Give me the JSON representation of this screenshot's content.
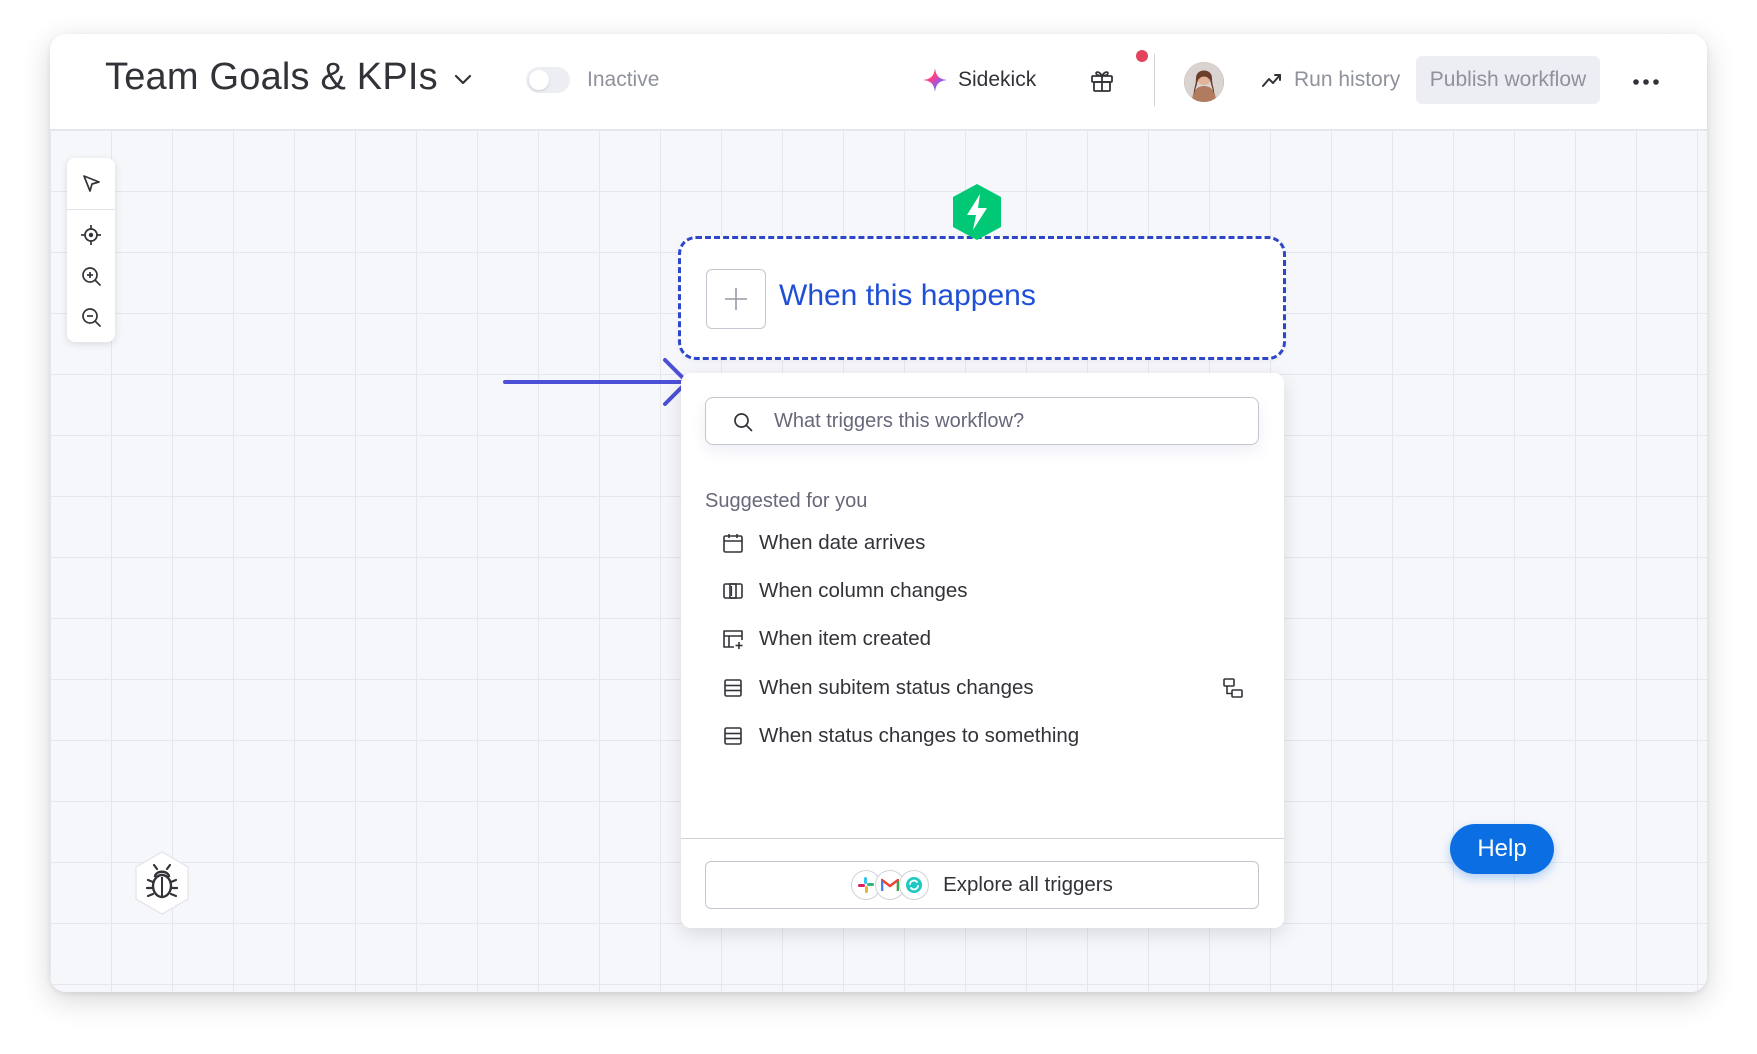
{
  "header": {
    "title": "Team Goals & KPIs",
    "status_label": "Inactive",
    "toggle_on": false,
    "sidekick_label": "Sidekick",
    "run_history_label": "Run history",
    "publish_label": "Publish workflow",
    "notification_dot_color": "#e2445c"
  },
  "canvas": {
    "tools": [
      {
        "icon": "pointer-icon"
      },
      {
        "icon": "recenter-icon"
      },
      {
        "icon": "zoom-in-icon"
      },
      {
        "icon": "zoom-out-icon"
      }
    ]
  },
  "trigger": {
    "label": "When this happens",
    "accent_color": "#2e47c8",
    "badge_color": "#00c875"
  },
  "dropdown": {
    "search_placeholder": "What triggers this workflow?",
    "section_label": "Suggested for you",
    "items": [
      {
        "label": "When date arrives",
        "icon": "calendar-icon"
      },
      {
        "label": "When column changes",
        "icon": "column-icon"
      },
      {
        "label": "When item created",
        "icon": "item-created-icon"
      },
      {
        "label": "When subitem status changes",
        "icon": "table-icon",
        "extra_icon": "subitem-icon"
      },
      {
        "label": "When status changes to something",
        "icon": "table-icon"
      }
    ],
    "explore_label": "Explore all triggers",
    "explore_app_icons": [
      "slack-icon",
      "gmail-icon",
      "refresh-app-icon"
    ]
  },
  "footer": {
    "help_label": "Help",
    "help_color": "#0b6fe3"
  },
  "annotation": {
    "arrow_color": "#4b50d6"
  }
}
